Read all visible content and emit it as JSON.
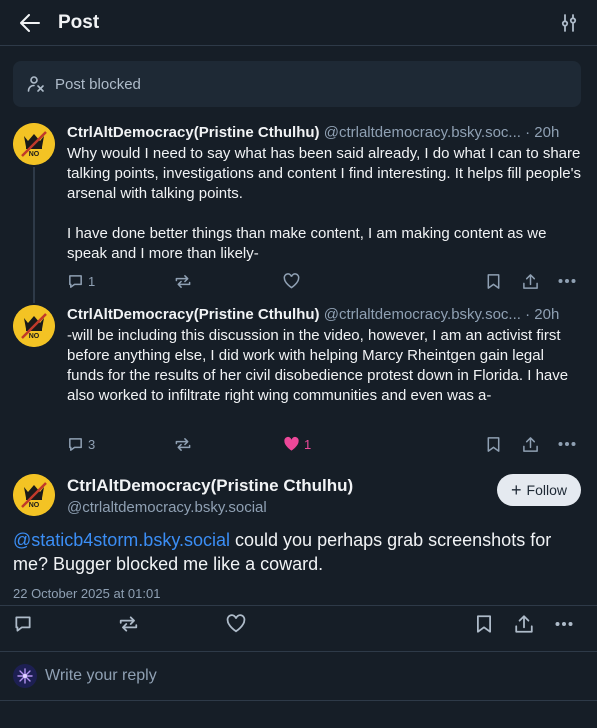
{
  "header": {
    "title": "Post"
  },
  "blocked": {
    "label": "Post blocked"
  },
  "replies": [
    {
      "name": "CtrlAltDemocracy(Pristine Cthulhu)",
      "handle": "@ctrlaltdemocracy.bsky.soc...",
      "time": "· 20h",
      "text": "Why would I need to say what has been said already, I do what I can to share talking points, investigations and content I find interesting. It helps fill people's arsenal with talking points.\n\nI have done better things than make content, I am making content as we speak and I more than likely-",
      "replies": "1",
      "likes": ""
    },
    {
      "name": "CtrlAltDemocracy(Pristine Cthulhu)",
      "handle": "@ctrlaltdemocracy.bsky.soc...",
      "time": "· 20h",
      "text": "-will be including this discussion in the video, however, I am an activist first before anything else, I did work with helping Marcy Rheintgen gain legal funds for the results of her civil disobedience protest down in Florida. I have also worked to infiltrate right wing communities and even was a-",
      "replies": "3",
      "likes": "1"
    }
  ],
  "main": {
    "name": "CtrlAltDemocracy(Pristine Cthulhu)",
    "handle": "@ctrlaltdemocracy.bsky.social",
    "follow_label": "Follow",
    "mention": "@staticb4storm.bsky.social",
    "text": " could you perhaps grab screenshots for me? Bugger blocked me like a coward.",
    "date": "22 October 2025 at 01:01"
  },
  "reply_bar": {
    "placeholder": "Write your reply"
  },
  "colors": {
    "background": "#161e27",
    "accent": "#3b8ef5",
    "like": "#ec4899",
    "avatar": "#f3c324"
  }
}
